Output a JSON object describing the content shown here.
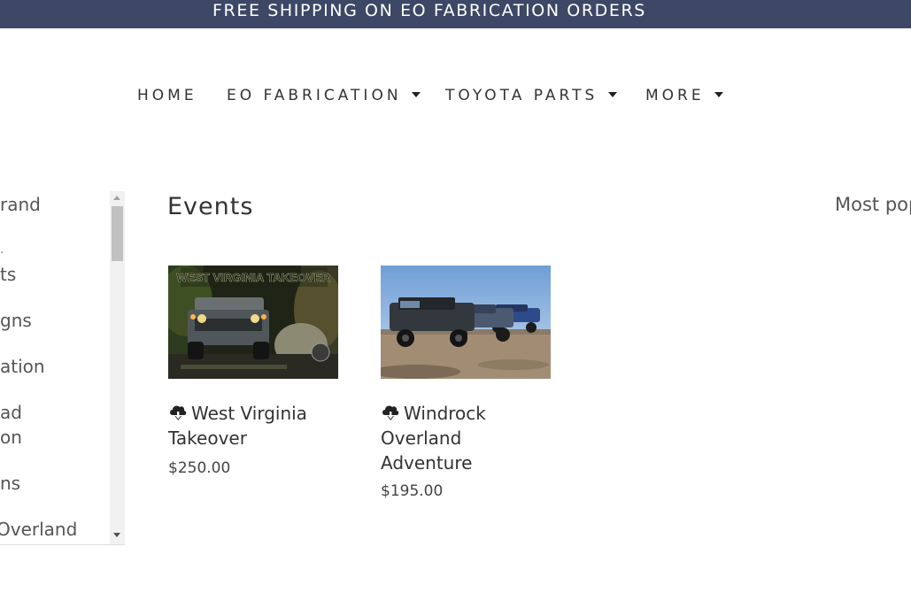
{
  "banner": {
    "text": "FREE SHIPPING ON EO FABRICATION ORDERS"
  },
  "colors": {
    "banner_bg": "#3d4766",
    "text": "#333333"
  },
  "nav": {
    "items": [
      {
        "label": "HOME",
        "has_dropdown": false
      },
      {
        "label": "EO FABRICATION",
        "has_dropdown": true
      },
      {
        "label": "TOYOTA PARTS",
        "has_dropdown": true
      },
      {
        "label": "MORE",
        "has_dropdown": true
      }
    ]
  },
  "sidebar": {
    "items": [
      {
        "line1": "rand",
        "line2": ""
      },
      {
        "line1": "ts",
        "line2": ""
      },
      {
        "line1": "gns",
        "line2": ""
      },
      {
        "line1": "ation",
        "line2": ""
      },
      {
        "line1": "ad",
        "line2": "on"
      },
      {
        "line1": "ns",
        "line2": ""
      },
      {
        "line1": "Overland",
        "line2": ""
      }
    ]
  },
  "main": {
    "title": "Events",
    "sort_label": "Most pop"
  },
  "products": [
    {
      "title": "West Virginia Takeover",
      "price": "$250.00",
      "image_caption": "WEST VIRGINIA TAKEOVER",
      "icon": "download-cloud-icon"
    },
    {
      "title": "Windrock Overland Adventure",
      "price": "$195.00",
      "icon": "download-cloud-icon"
    }
  ]
}
